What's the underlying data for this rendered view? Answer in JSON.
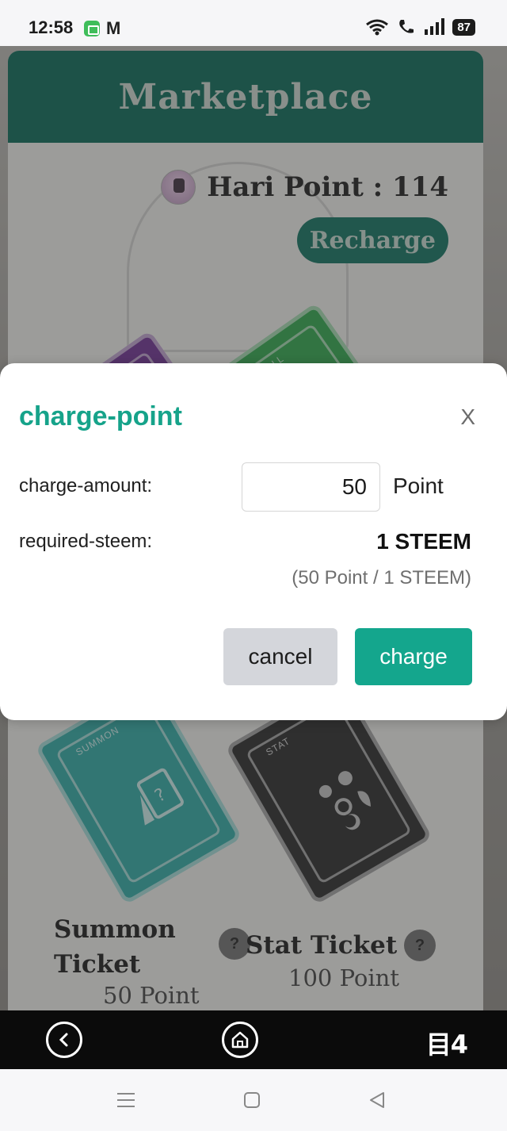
{
  "status_bar": {
    "time": "12:58",
    "battery": "87",
    "icons": [
      "app-notification-icon",
      "gmail-icon",
      "wifi-icon",
      "wifi-call-icon",
      "signal-icon",
      "battery-icon"
    ]
  },
  "page": {
    "title": "Marketplace",
    "points_label": "Hari Point : 114",
    "recharge_label": "Recharge",
    "tickets": [
      {
        "name": "Summon Ticket",
        "price": "50 Point",
        "help": "?",
        "tag": "SUMMON"
      },
      {
        "name": "Stat Ticket",
        "price": "100 Point",
        "help": "?",
        "tag": "STAT"
      }
    ],
    "partial_tickets": [
      {
        "tag": "",
        "color": "#6a2c8f"
      },
      {
        "tag": "REROLL",
        "color": "#2aa347"
      }
    ]
  },
  "modal": {
    "title": "charge-point",
    "close_label": "X",
    "amount_label": "charge-amount:",
    "amount_value": "50",
    "amount_unit": "Point",
    "steem_label": "required-steem:",
    "steem_value": "1 STEEM",
    "rate_note": "(50 Point / 1 STEEM)",
    "cancel_label": "cancel",
    "charge_label": "charge"
  },
  "app_bar": {
    "brand_label": "目4"
  },
  "colors": {
    "accent": "#14a68d",
    "header": "#046552",
    "cancel_bg": "#d4d6db"
  }
}
